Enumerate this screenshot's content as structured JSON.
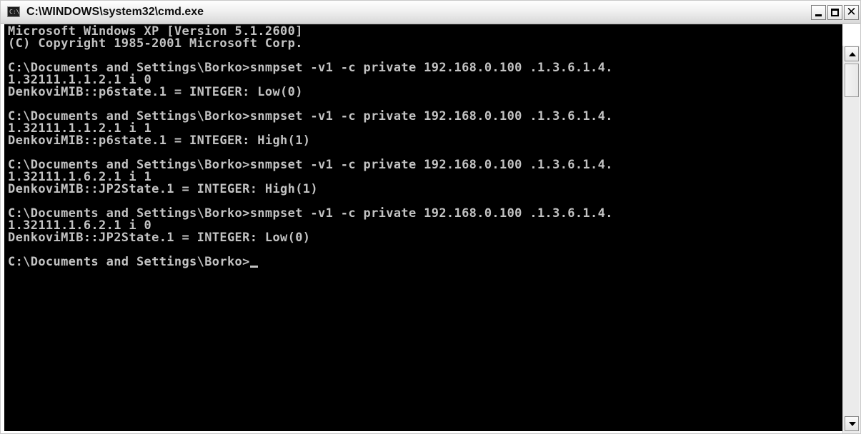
{
  "window": {
    "title": "C:\\WINDOWS\\system32\\cmd.exe",
    "icon": "console-icon",
    "icon_glyph": "C:\\",
    "controls": {
      "minimize_icon": "minimize-icon",
      "maximize_icon": "maximize-icon",
      "close_icon": "close-icon",
      "close_glyph": "✕"
    }
  },
  "console": {
    "colors": {
      "background": "#000000",
      "text": "#c3c3c3"
    },
    "lines": [
      "Microsoft Windows XP [Version 5.1.2600]",
      "(C) Copyright 1985-2001 Microsoft Corp.",
      "",
      "C:\\Documents and Settings\\Borko>snmpset -v1 -c private 192.168.0.100 .1.3.6.1.4.",
      "1.32111.1.1.2.1 i 0",
      "DenkoviMIB::p6state.1 = INTEGER: Low(0)",
      "",
      "C:\\Documents and Settings\\Borko>snmpset -v1 -c private 192.168.0.100 .1.3.6.1.4.",
      "1.32111.1.1.2.1 i 1",
      "DenkoviMIB::p6state.1 = INTEGER: High(1)",
      "",
      "C:\\Documents and Settings\\Borko>snmpset -v1 -c private 192.168.0.100 .1.3.6.1.4.",
      "1.32111.1.6.2.1 i 1",
      "DenkoviMIB::JP2State.1 = INTEGER: High(1)",
      "",
      "C:\\Documents and Settings\\Borko>snmpset -v1 -c private 192.168.0.100 .1.3.6.1.4.",
      "1.32111.1.6.2.1 i 0",
      "DenkoviMIB::JP2State.1 = INTEGER: Low(0)",
      "",
      "C:\\Documents and Settings\\Borko>"
    ]
  },
  "scrollbar": {
    "up_icon": "scroll-up-arrow-icon",
    "down_icon": "scroll-down-arrow-icon",
    "position_fraction": 0.0
  }
}
